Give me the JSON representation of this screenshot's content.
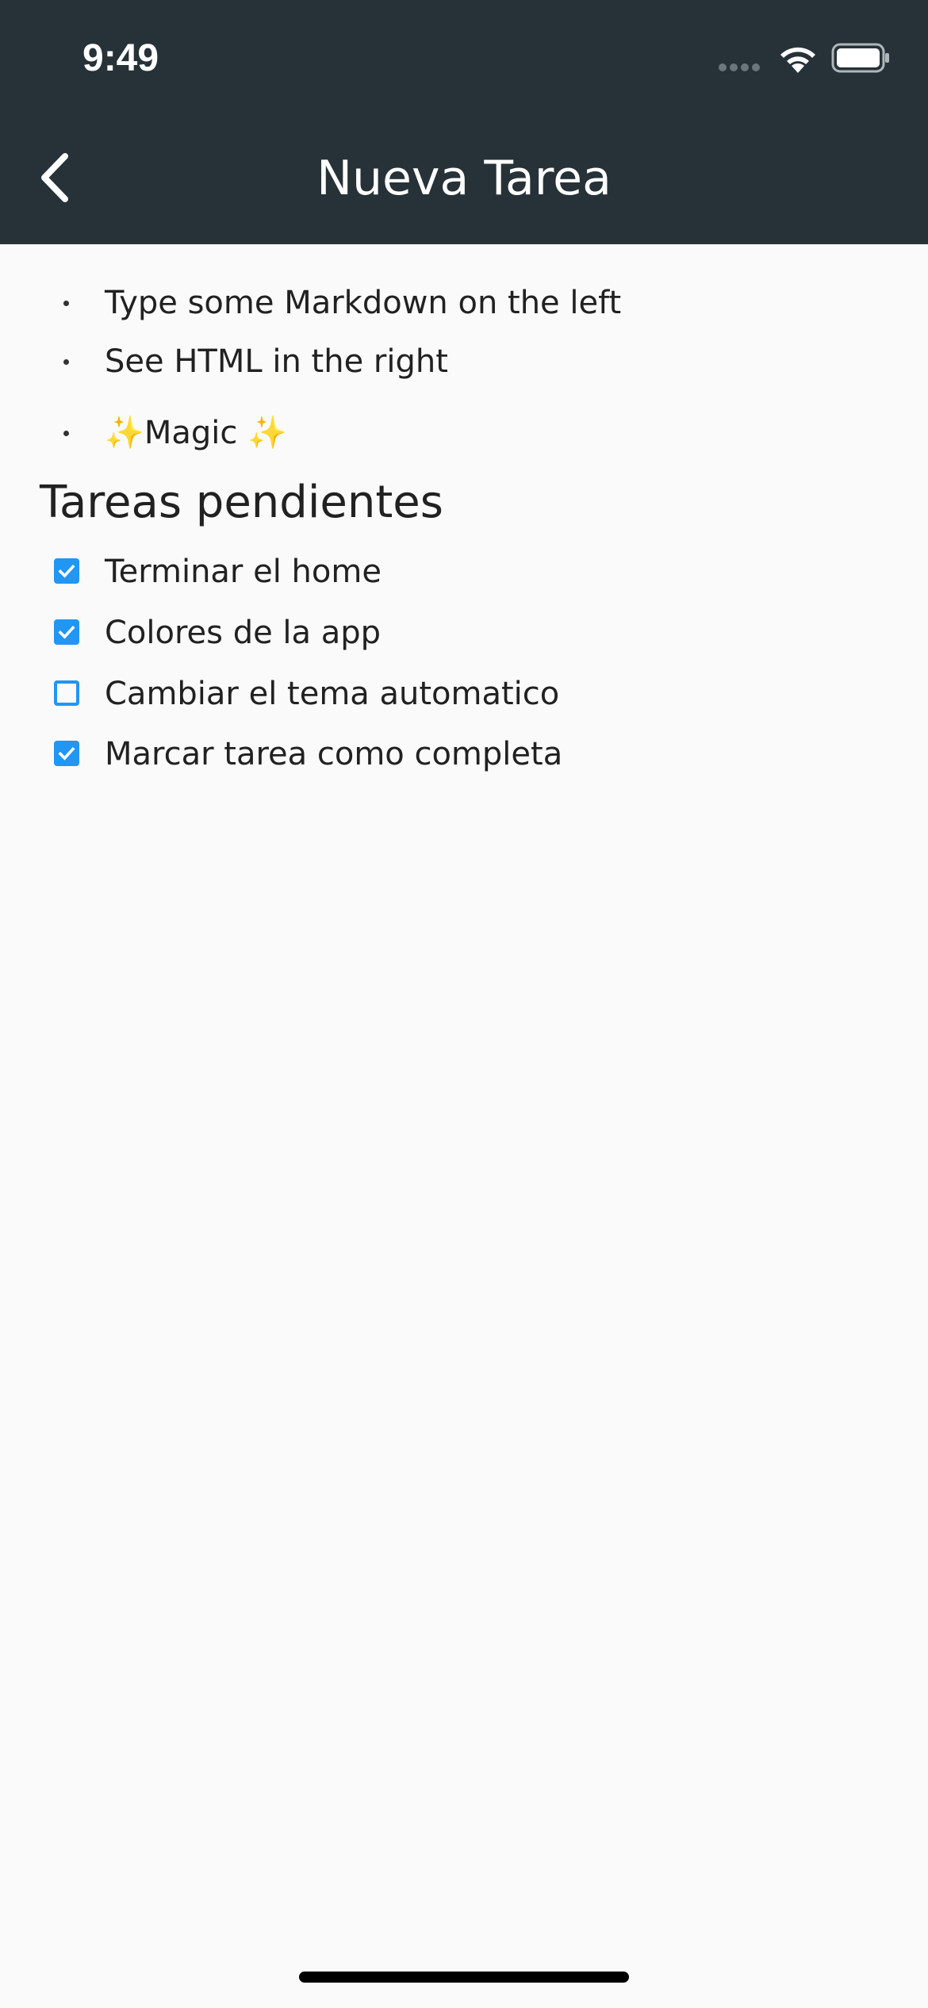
{
  "status_bar": {
    "time": "9:49",
    "cellular_icon": "signal-dots-icon",
    "wifi_icon": "wifi-icon",
    "battery_icon": "battery-icon"
  },
  "app_bar": {
    "title": "Nueva Tarea",
    "back_icon": "chevron-left-icon",
    "background_color": "#263238"
  },
  "content": {
    "bullets": [
      {
        "text": "Type some Markdown on the left"
      },
      {
        "text": "See HTML in the right"
      },
      {
        "sparkle_left": "✨",
        "text": "Magic ",
        "sparkle_right": "✨"
      }
    ],
    "heading": "Tareas pendientes",
    "tasks": [
      {
        "label": "Terminar el home",
        "checked": true
      },
      {
        "label": "Colores de la app",
        "checked": true
      },
      {
        "label": "Cambiar el tema automatico",
        "checked": false
      },
      {
        "label": "Marcar tarea como completa",
        "checked": true
      }
    ],
    "accent_color": "#2196f3"
  }
}
